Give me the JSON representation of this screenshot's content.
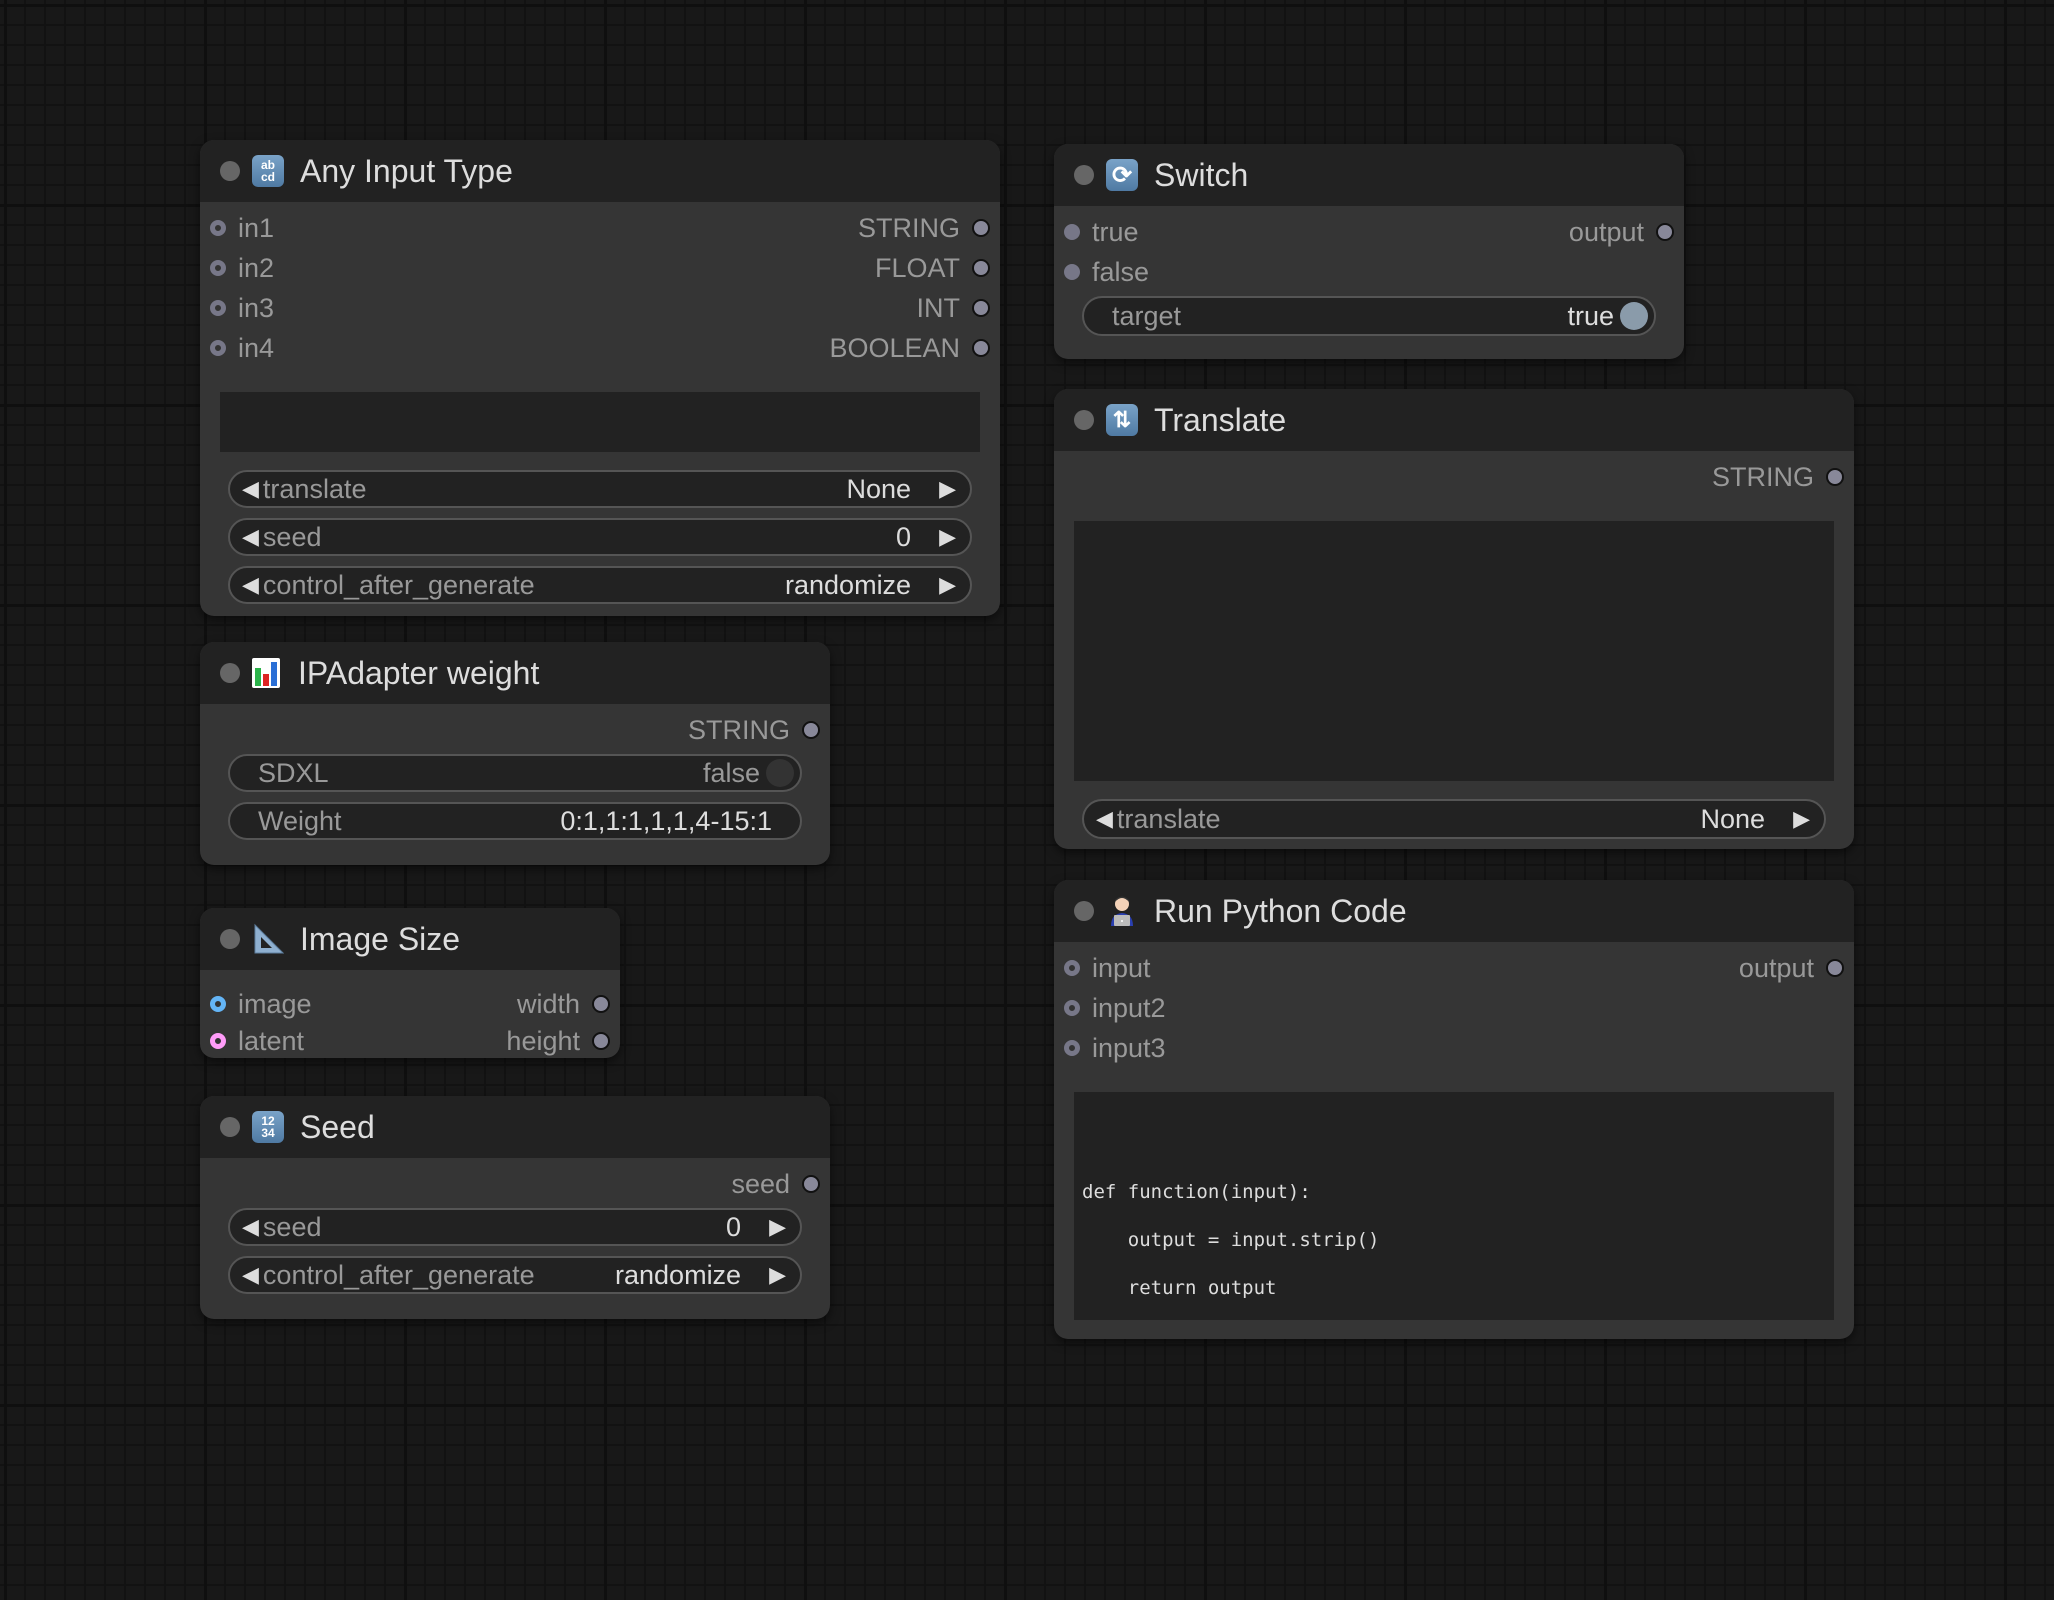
{
  "nodes": {
    "any_input_type": {
      "title": "Any Input Type",
      "icon": "abcd-icon",
      "inputs": [
        "in1",
        "in2",
        "in3",
        "in4"
      ],
      "outputs": [
        "STRING",
        "FLOAT",
        "INT",
        "BOOLEAN"
      ],
      "text_value": "",
      "widgets": [
        {
          "label": "translate",
          "value": "None"
        },
        {
          "label": "seed",
          "value": "0"
        },
        {
          "label": "control_after_generate",
          "value": "randomize"
        }
      ]
    },
    "ipadapter_weight": {
      "title": "IPAdapter weight",
      "icon": "bar-chart-icon",
      "outputs": [
        "STRING"
      ],
      "toggle": {
        "label": "SDXL",
        "value": "false"
      },
      "weight": {
        "label": "Weight",
        "value": "0:1,1:1,1,1,4-15:1"
      }
    },
    "image_size": {
      "title": "Image Size",
      "icon": "triangular-ruler-icon",
      "inputs": [
        "image",
        "latent"
      ],
      "outputs": [
        "width",
        "height"
      ],
      "input_colors": {
        "image": "#64B5F6",
        "latent": "#FF9CF9"
      }
    },
    "seed": {
      "title": "Seed",
      "icon": "numbers-1234-icon",
      "outputs": [
        "seed"
      ],
      "widgets": [
        {
          "label": "seed",
          "value": "0"
        },
        {
          "label": "control_after_generate",
          "value": "randomize"
        }
      ]
    },
    "switch": {
      "title": "Switch",
      "icon": "refresh-arrows-icon",
      "inputs": [
        "true",
        "false"
      ],
      "outputs": [
        "output"
      ],
      "toggle": {
        "label": "target",
        "value": "true"
      }
    },
    "translate": {
      "title": "Translate",
      "icon": "repeat-arrows-icon",
      "outputs": [
        "STRING"
      ],
      "text_value": "",
      "widgets": [
        {
          "label": "translate",
          "value": "None"
        }
      ]
    },
    "run_python_code": {
      "title": "Run Python Code",
      "icon": "technologist-icon",
      "inputs": [
        "input",
        "input2",
        "input3"
      ],
      "outputs": [
        "output"
      ],
      "code": "\n\n\ndef function(input):\n\n    output = input.strip()\n\n    return output"
    }
  },
  "colors": {
    "toggle_on_knob": "#8A9BAA",
    "toggle_off_knob": "#333333",
    "slot_default": "#777788"
  }
}
